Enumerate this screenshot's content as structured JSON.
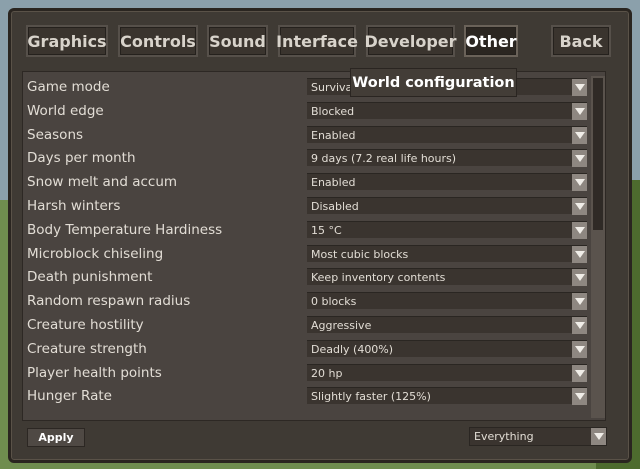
{
  "tabs": [
    {
      "label": "Graphics",
      "active": false
    },
    {
      "label": "Controls",
      "active": false
    },
    {
      "label": "Sound",
      "active": false
    },
    {
      "label": "Interface",
      "active": false
    },
    {
      "label": "Developer",
      "active": false
    },
    {
      "label": "Other",
      "active": true
    }
  ],
  "back_label": "Back",
  "tooltip": "World configuration",
  "settings": [
    {
      "label": "Game mode",
      "value": "Survival"
    },
    {
      "label": "World edge",
      "value": "Blocked"
    },
    {
      "label": "Seasons",
      "value": "Enabled"
    },
    {
      "label": "Days per month",
      "value": "9 days (7.2 real life hours)"
    },
    {
      "label": "Snow melt and accum",
      "value": "Enabled"
    },
    {
      "label": "Harsh winters",
      "value": "Disabled"
    },
    {
      "label": "Body Temperature Hardiness",
      "value": "15 °C"
    },
    {
      "label": "Microblock chiseling",
      "value": "Most cubic blocks"
    },
    {
      "label": "Death punishment",
      "value": "Keep inventory contents"
    },
    {
      "label": "Random respawn radius",
      "value": "0 blocks"
    },
    {
      "label": "Creature hostility",
      "value": "Aggressive"
    },
    {
      "label": "Creature strength",
      "value": "Deadly (400%)"
    },
    {
      "label": "Player health points",
      "value": "20 hp"
    },
    {
      "label": "Hunger Rate",
      "value": "Slightly faster (125%)"
    }
  ],
  "apply_label": "Apply",
  "filter_value": "Everything"
}
